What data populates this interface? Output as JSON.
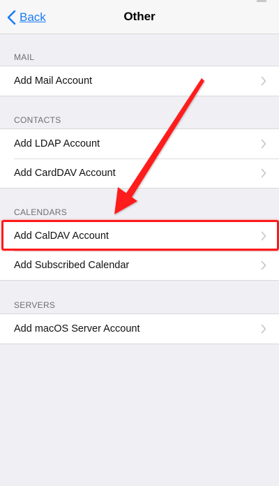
{
  "navbar": {
    "back_label": "Back",
    "title": "Other"
  },
  "sections": [
    {
      "header": "MAIL",
      "items": [
        {
          "label": "Add Mail Account"
        }
      ]
    },
    {
      "header": "CONTACTS",
      "items": [
        {
          "label": "Add LDAP Account"
        },
        {
          "label": "Add CardDAV Account"
        }
      ]
    },
    {
      "header": "CALENDARS",
      "items": [
        {
          "label": "Add CalDAV Account",
          "highlighted": true
        },
        {
          "label": "Add Subscribed Calendar"
        }
      ]
    },
    {
      "header": "SERVERS",
      "items": [
        {
          "label": "Add macOS Server Account"
        }
      ]
    }
  ],
  "annotation": {
    "arrow_color": "#ff1a1a",
    "highlight_color": "#ff1a1a",
    "points_to": "Add CalDAV Account"
  },
  "colors": {
    "accent": "#1a7cf5",
    "background": "#efeff4"
  },
  "icons": {
    "back": "chevron-left-icon",
    "disclosure": "chevron-right-icon"
  }
}
